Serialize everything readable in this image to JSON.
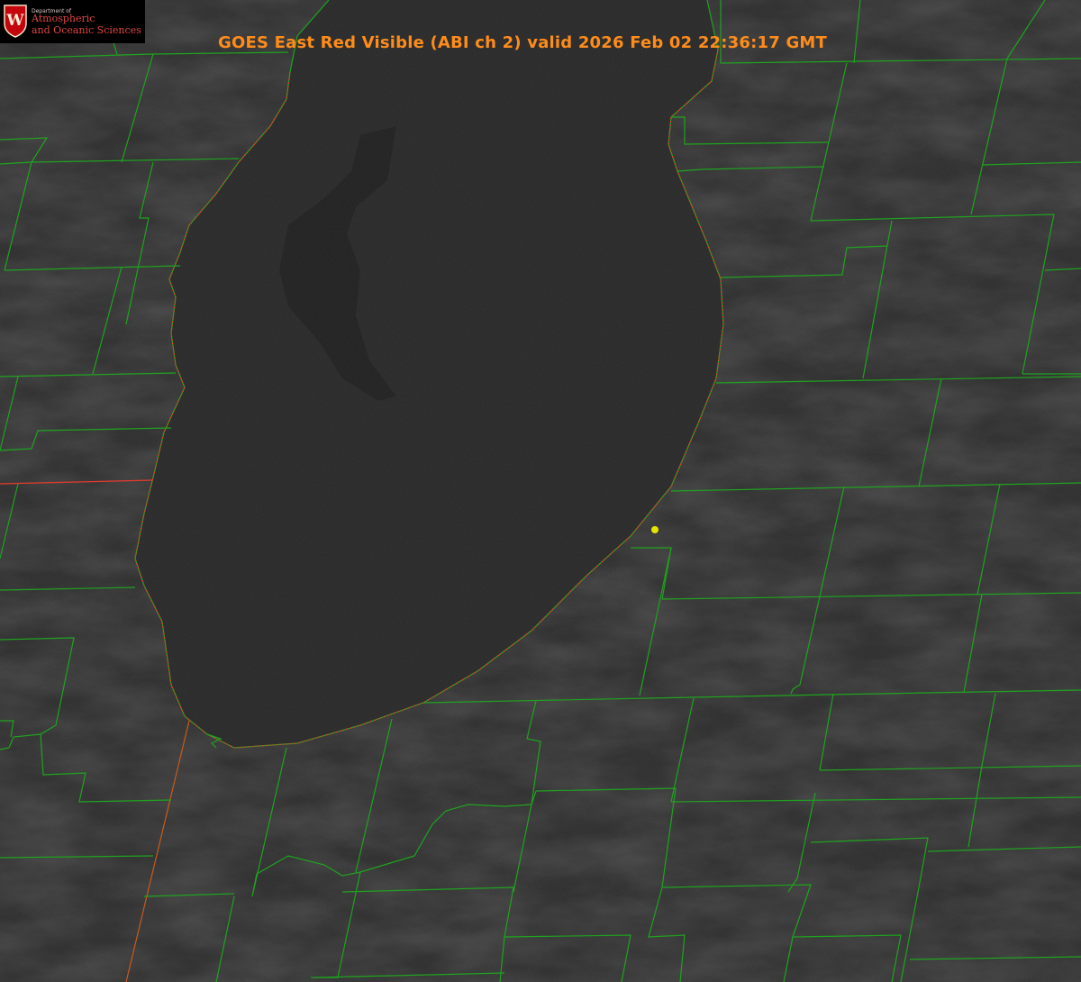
{
  "header": {
    "title": "GOES East Red Visible (ABI ch 2) valid 2026 Feb 02 22:36:17 GMT"
  },
  "logo": {
    "line_small": "Department of",
    "line1": "Atmospheric",
    "line2": "and Oceanic Sciences",
    "seal_letter": "W"
  },
  "colors": {
    "background": "#2a2a2a",
    "lake": "#262626",
    "county_lines": "#1fa31f",
    "state_line": "#e53b2e",
    "title_text": "#ff8c1a",
    "marker": "#e5e500"
  },
  "map": {
    "features": [
      "county-boundaries",
      "state-boundary",
      "lake-shoreline",
      "location-marker"
    ]
  }
}
